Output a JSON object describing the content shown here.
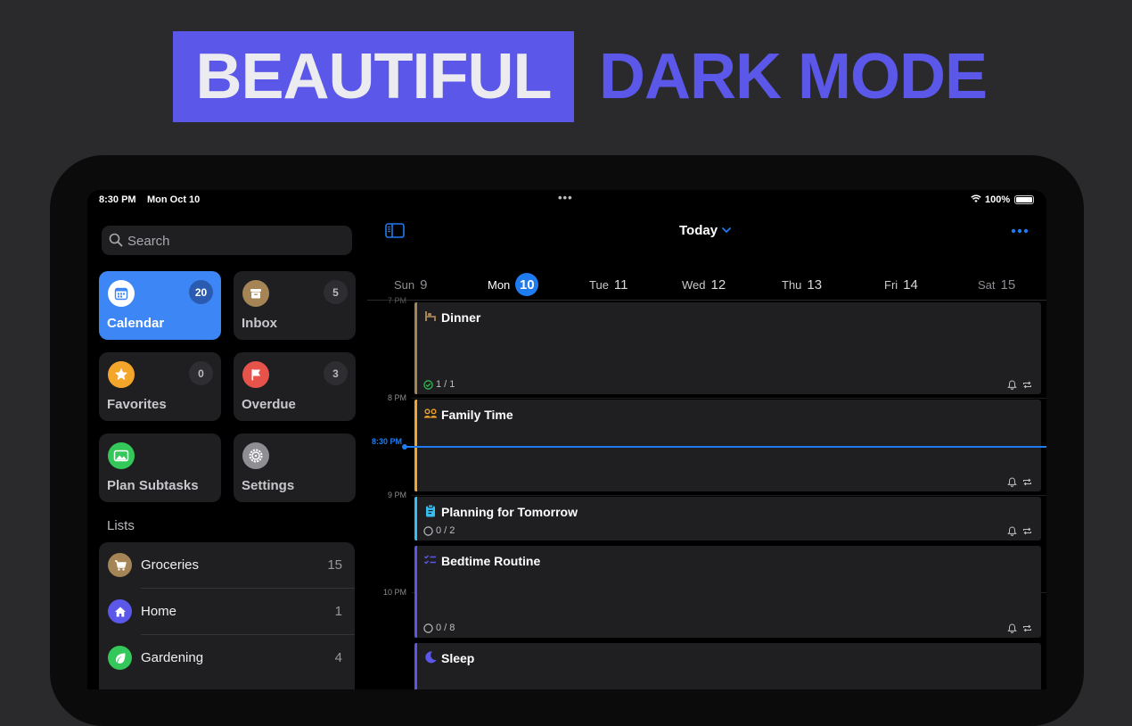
{
  "hero": {
    "word1": "BEAUTIFUL",
    "word2": "DARK MODE"
  },
  "status": {
    "time": "8:30 PM",
    "date": "Mon Oct 10",
    "battery": "100%"
  },
  "sidebar": {
    "search_placeholder": "Search",
    "tiles": [
      {
        "label": "Calendar",
        "count": "20"
      },
      {
        "label": "Inbox",
        "count": "5"
      },
      {
        "label": "Favorites",
        "count": "0"
      },
      {
        "label": "Overdue",
        "count": "3"
      },
      {
        "label": "Plan Subtasks"
      },
      {
        "label": "Settings"
      }
    ],
    "lists_heading": "Lists",
    "lists": [
      {
        "name": "Groceries",
        "count": "15",
        "icon": "cart-icon",
        "color": "#a58456"
      },
      {
        "name": "Home",
        "count": "1",
        "icon": "home-icon",
        "color": "#5b57e8"
      },
      {
        "name": "Gardening",
        "count": "4",
        "icon": "leaf-icon",
        "color": "#34c759"
      }
    ]
  },
  "header": {
    "title": "Today"
  },
  "week": [
    {
      "name": "Sun",
      "num": "9"
    },
    {
      "name": "Mon",
      "num": "10"
    },
    {
      "name": "Tue",
      "num": "11"
    },
    {
      "name": "Wed",
      "num": "12"
    },
    {
      "name": "Thu",
      "num": "13"
    },
    {
      "name": "Fri",
      "num": "14"
    },
    {
      "name": "Sat",
      "num": "15"
    }
  ],
  "timeline": {
    "top_label": "7 PM",
    "hours": [
      "8 PM",
      "9 PM",
      "10 PM"
    ],
    "now_label": "8:30 PM",
    "events": [
      {
        "title": "Dinner",
        "progress": "1 / 1",
        "color": "#a58456",
        "icon": "dinner-icon"
      },
      {
        "title": "Family Time",
        "color": "#f4a62a",
        "icon": "family-icon"
      },
      {
        "title": "Planning for Tomorrow",
        "progress": "0 / 2",
        "color": "#38bdf2",
        "icon": "clipboard-icon"
      },
      {
        "title": "Bedtime Routine",
        "progress": "0 / 8",
        "color": "#5b57e8",
        "icon": "checklist-icon"
      },
      {
        "title": "Sleep",
        "color": "#5b57e8",
        "icon": "moon-icon"
      }
    ]
  },
  "colors": {
    "accent": "#5b57e8",
    "blue": "#1f7bf0",
    "card": "#1f1f22"
  }
}
